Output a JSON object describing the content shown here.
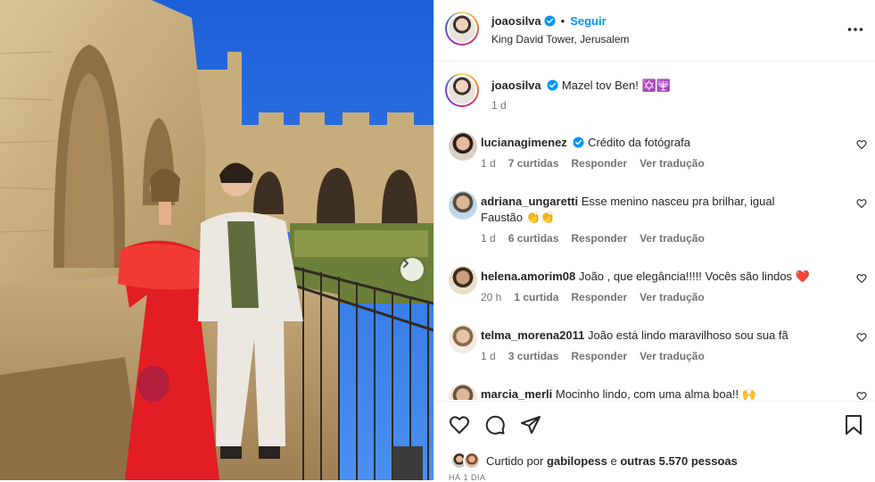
{
  "header": {
    "username": "joaosilva",
    "follow_label": "Seguir",
    "location": "King David Tower, Jerusalem",
    "dot": "•"
  },
  "caption": {
    "username": "joaosilva",
    "text": "Mazel tov Ben! ✡️🕎",
    "time": "1 d"
  },
  "comments": [
    {
      "username": "lucianagimenez",
      "verified": true,
      "text": "Crédito da fotógrafa",
      "time": "1 d",
      "likes": "7 curtidas",
      "reply": "Responder",
      "translate": "Ver tradução"
    },
    {
      "username": "adriana_ungaretti",
      "verified": false,
      "text": "Esse menino nasceu pra brilhar, igual Faustão 👏👏",
      "time": "1 d",
      "likes": "6 curtidas",
      "reply": "Responder",
      "translate": "Ver tradução"
    },
    {
      "username": "helena.amorim08",
      "verified": false,
      "text": "João , que elegância!!!!! Vocês são lindos ❤️",
      "time": "20 h",
      "likes": "1 curtida",
      "reply": "Responder",
      "translate": "Ver tradução"
    },
    {
      "username": "telma_morena2011",
      "verified": false,
      "text": "João está lindo maravilhoso sou sua fã",
      "time": "1 d",
      "likes": "3 curtidas",
      "reply": "Responder",
      "translate": "Ver tradução"
    },
    {
      "username": "marcia_merli",
      "verified": false,
      "text": "Mocinho lindo, com uma alma boa!! 🙌",
      "time": "",
      "likes": "",
      "reply": "",
      "translate": ""
    }
  ],
  "likes": {
    "prefix": "Curtido por",
    "user": "gabilopess",
    "connector": "e",
    "others": "outras 5.570 pessoas"
  },
  "posted_ago": "HÁ 1 DIA",
  "colors": {
    "accent": "#0095f6",
    "verified": "#0095f6",
    "heart_red": "#ed4956",
    "muted": "#737373"
  },
  "icons": [
    "heart-icon",
    "comment-icon",
    "share-icon",
    "bookmark-icon",
    "more-icon",
    "verified-icon",
    "next-arrow-icon"
  ]
}
